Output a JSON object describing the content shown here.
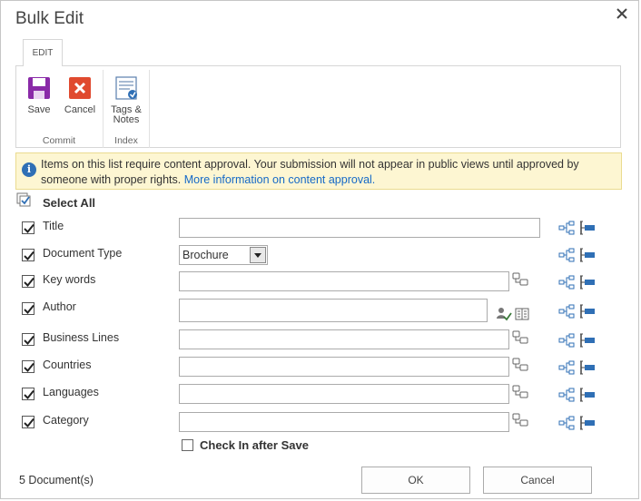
{
  "dialog": {
    "title": "Bulk Edit"
  },
  "ribbon": {
    "tab": "EDIT",
    "buttons": {
      "save": "Save",
      "cancel": "Cancel",
      "tags_line1": "Tags &",
      "tags_line2": "Notes"
    },
    "groups": {
      "commit": "Commit",
      "index": "Index"
    }
  },
  "info": {
    "message": "Items on this list require content approval. Your submission will not appear in public views until approved by someone with proper rights.",
    "link": "More information on content approval."
  },
  "select_all": "Select All",
  "fields": [
    {
      "label": "Title",
      "value": ""
    },
    {
      "label": "Document Type",
      "value": "Brochure"
    },
    {
      "label": "Key words",
      "value": ""
    },
    {
      "label": "Author",
      "value": ""
    },
    {
      "label": "Business Lines",
      "value": ""
    },
    {
      "label": "Countries",
      "value": ""
    },
    {
      "label": "Languages",
      "value": ""
    },
    {
      "label": "Category",
      "value": ""
    }
  ],
  "checkin_label": "Check In after Save",
  "doc_count": "5  Document(s)",
  "buttons": {
    "ok": "OK",
    "cancel": "Cancel"
  },
  "colors": {
    "save_purple": "#8a2aa8",
    "cancel_red": "#e04a2f",
    "link_blue": "#1569c7",
    "icon_blue": "#2f6fb5",
    "info_bg": "#fdf6d2"
  }
}
